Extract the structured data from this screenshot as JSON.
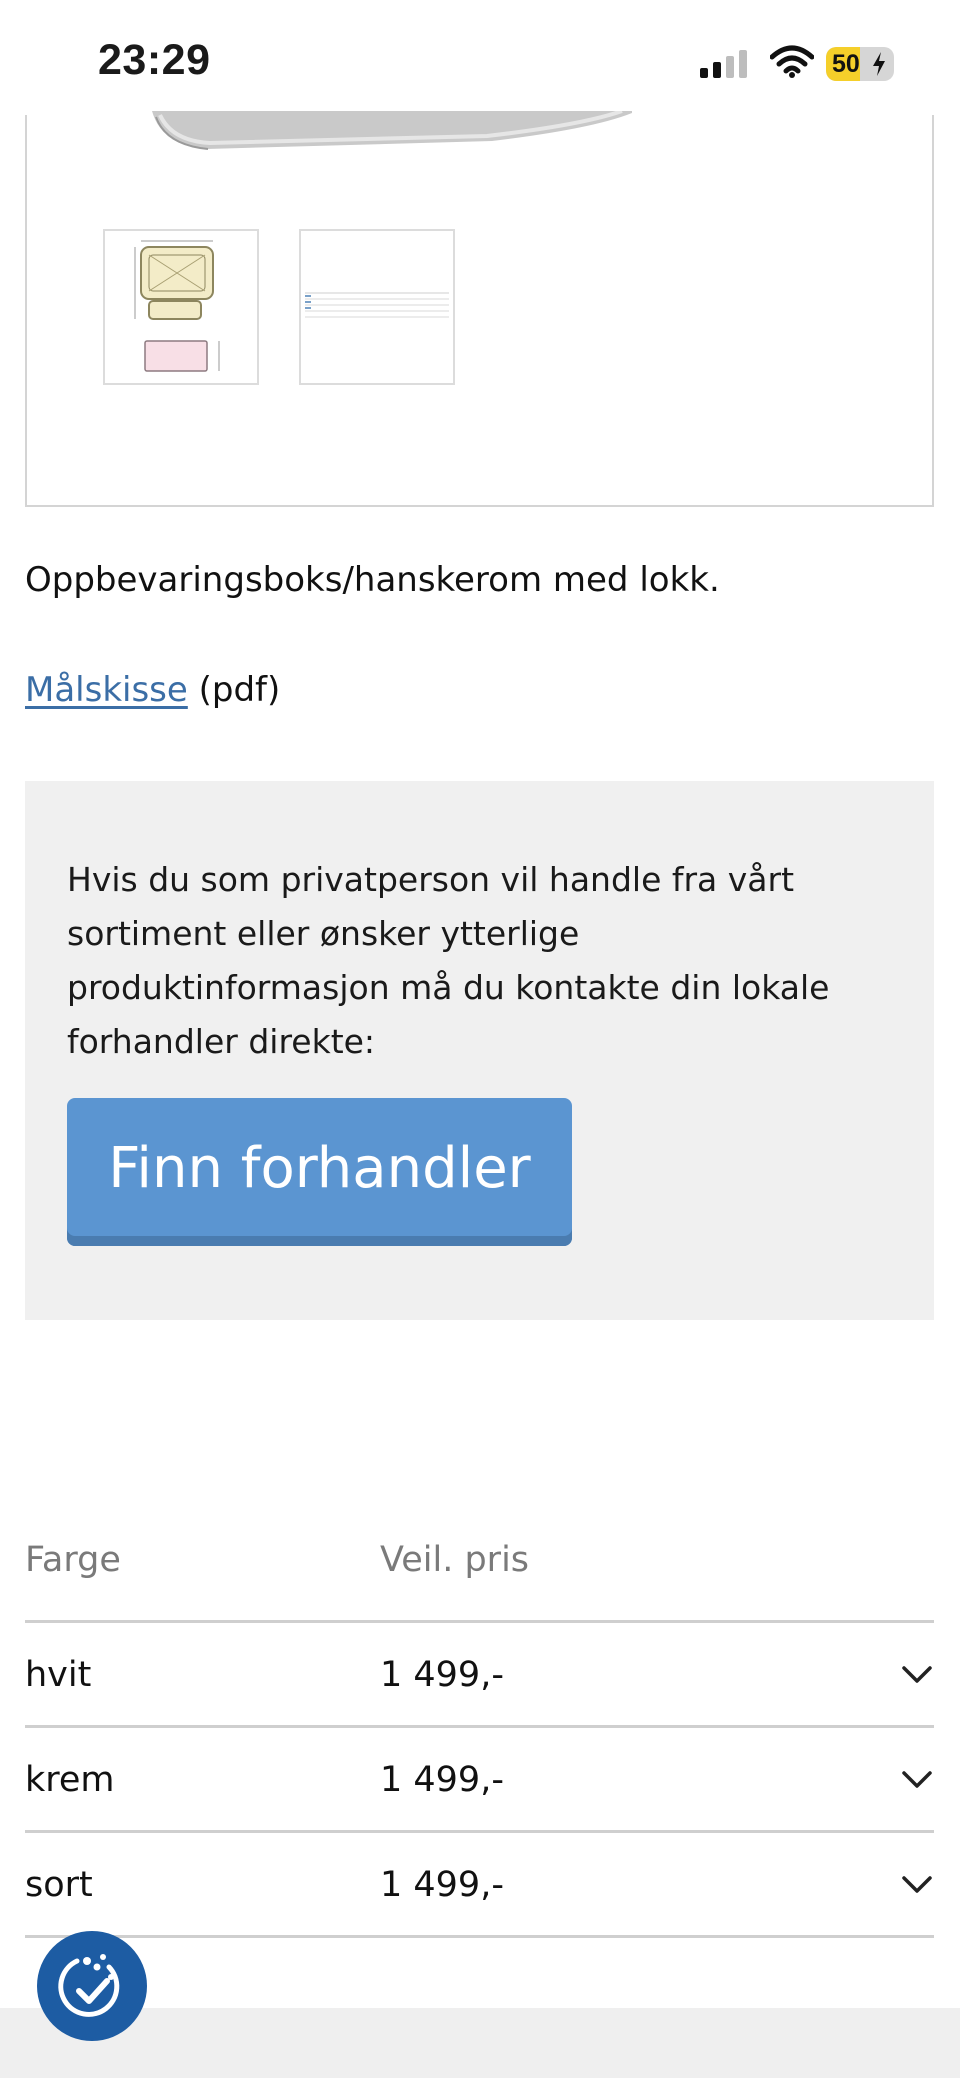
{
  "status_bar": {
    "time": "23:29",
    "battery_level": "50",
    "battery_fraction": 0.5
  },
  "gallery": {
    "thumbnails": [
      {
        "name": "dimension-drawing-thumbnail"
      },
      {
        "name": "spec-table-thumbnail"
      }
    ]
  },
  "product": {
    "description": "Oppbevaringsboks/hanskerom med lokk.",
    "pdf_link_label": "Målskisse",
    "pdf_suffix": "(pdf)"
  },
  "dealer_box": {
    "text": "Hvis du som privatperson vil handle fra vårt sortiment eller ønsker ytterlige produktinformasjon må du kontakte din lokale forhandler direkte:",
    "button_label": "Finn forhandler"
  },
  "variants": {
    "headers": {
      "color": "Farge",
      "price": "Veil. pris"
    },
    "rows": [
      {
        "color": "hvit",
        "price": "1 499,-"
      },
      {
        "color": "krem",
        "price": "1 499,-"
      },
      {
        "color": "sort",
        "price": "1 499,-"
      }
    ]
  },
  "colors": {
    "accent_button": "#5b95d1",
    "link": "#3b6ea6",
    "cookie_button": "#1d5ca3",
    "battery": "#f5cf2a"
  },
  "icons": {
    "signal": "cellular-signal-icon",
    "wifi": "wifi-icon",
    "battery": "battery-charging-icon",
    "chevron": "chevron-down-icon",
    "cookie": "cookie-consent-icon"
  }
}
